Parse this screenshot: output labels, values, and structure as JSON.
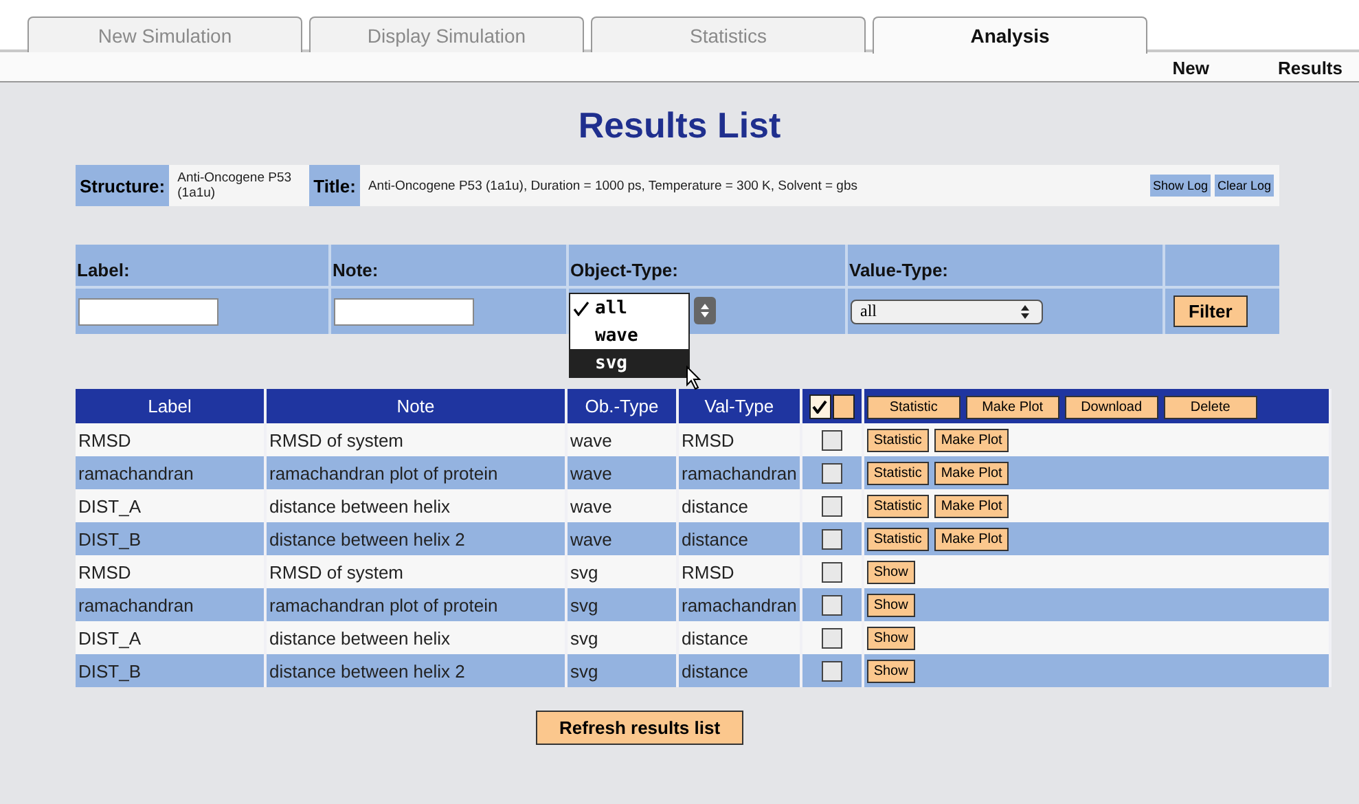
{
  "tabs": [
    {
      "label": "New Simulation",
      "selected": false
    },
    {
      "label": "Display Simulation",
      "selected": false
    },
    {
      "label": "Statistics",
      "selected": false
    },
    {
      "label": "Analysis",
      "selected": true
    }
  ],
  "subnav": [
    "New",
    "Results"
  ],
  "title": "Results List",
  "info": {
    "structure_label": "Structure:",
    "structure": "Anti-Oncogene P53 (1a1u)",
    "title_label": "Title:",
    "title": "Anti-Oncogene P53 (1a1u), Duration = 1000 ps, Temperature = 300 K, Solvent = gbs",
    "buttons": [
      "Show Log",
      "Clear Log"
    ]
  },
  "filter": {
    "label_heading": "Label:",
    "note_heading": "Note:",
    "object_type_heading": "Object-Type:",
    "value_type_heading": "Value-Type:",
    "value_type": "all",
    "button": "Filter",
    "object_type_options": [
      {
        "label": "all",
        "selected": true,
        "highlighted": false
      },
      {
        "label": "wave",
        "selected": false,
        "highlighted": false
      },
      {
        "label": "svg",
        "selected": false,
        "highlighted": true
      }
    ]
  },
  "table": {
    "columns": [
      "Label",
      "Note",
      "Ob.-Type",
      "Val-Type"
    ],
    "select_all": {
      "checked": true
    },
    "header_buttons": [
      "Statistic",
      "Make Plot",
      "Download",
      "Delete"
    ],
    "rows": [
      {
        "label": "RMSD",
        "note": "RMSD of system",
        "ob_type": "wave",
        "val_type": "RMSD",
        "checked": false,
        "actions": [
          "Statistic",
          "Make Plot"
        ]
      },
      {
        "label": "ramachandran",
        "note": "ramachandran plot of protein",
        "ob_type": "wave",
        "val_type": "ramachandran",
        "checked": false,
        "actions": [
          "Statistic",
          "Make Plot"
        ]
      },
      {
        "label": "DIST_A",
        "note": "distance between helix",
        "ob_type": "wave",
        "val_type": "distance",
        "checked": false,
        "actions": [
          "Statistic",
          "Make Plot"
        ]
      },
      {
        "label": "DIST_B",
        "note": "distance between helix 2",
        "ob_type": "wave",
        "val_type": "distance",
        "checked": false,
        "actions": [
          "Statistic",
          "Make Plot"
        ]
      },
      {
        "label": "RMSD",
        "note": "RMSD of system",
        "ob_type": "svg",
        "val_type": "RMSD",
        "checked": false,
        "actions": [
          "Show"
        ]
      },
      {
        "label": "ramachandran",
        "note": "ramachandran plot of protein",
        "ob_type": "svg",
        "val_type": "ramachandran",
        "checked": false,
        "actions": [
          "Show"
        ]
      },
      {
        "label": "DIST_A",
        "note": "distance between helix",
        "ob_type": "svg",
        "val_type": "distance",
        "checked": false,
        "actions": [
          "Show"
        ]
      },
      {
        "label": "DIST_B",
        "note": "distance between helix 2",
        "ob_type": "svg",
        "val_type": "distance",
        "checked": false,
        "actions": [
          "Show"
        ]
      }
    ]
  },
  "refresh_button": "Refresh results list"
}
